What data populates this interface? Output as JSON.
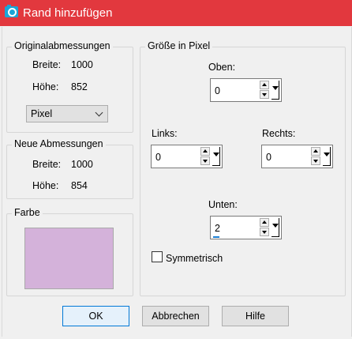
{
  "window": {
    "title": "Rand hinzufügen",
    "app_icon": "camera-icon",
    "accent": "#e2383e"
  },
  "original": {
    "group_label": "Originalabmessungen",
    "width_label": "Breite:",
    "width_value": "1000",
    "height_label": "Höhe:",
    "height_value": "852",
    "unit_selected": "Pixel"
  },
  "new": {
    "group_label": "Neue Abmessungen",
    "width_label": "Breite:",
    "width_value": "1000",
    "height_label": "Höhe:",
    "height_value": "854"
  },
  "color": {
    "group_label": "Farbe",
    "swatch": "#d4b2da"
  },
  "size": {
    "group_label": "Größe in Pixel",
    "top_label": "Oben:",
    "top_value": "0",
    "left_label": "Links:",
    "left_value": "0",
    "right_label": "Rechts:",
    "right_value": "0",
    "bottom_label": "Unten:",
    "bottom_value": "2",
    "symmetric_label": "Symmetrisch",
    "symmetric_checked": false
  },
  "buttons": {
    "ok": "OK",
    "cancel": "Abbrechen",
    "help": "Hilfe"
  }
}
